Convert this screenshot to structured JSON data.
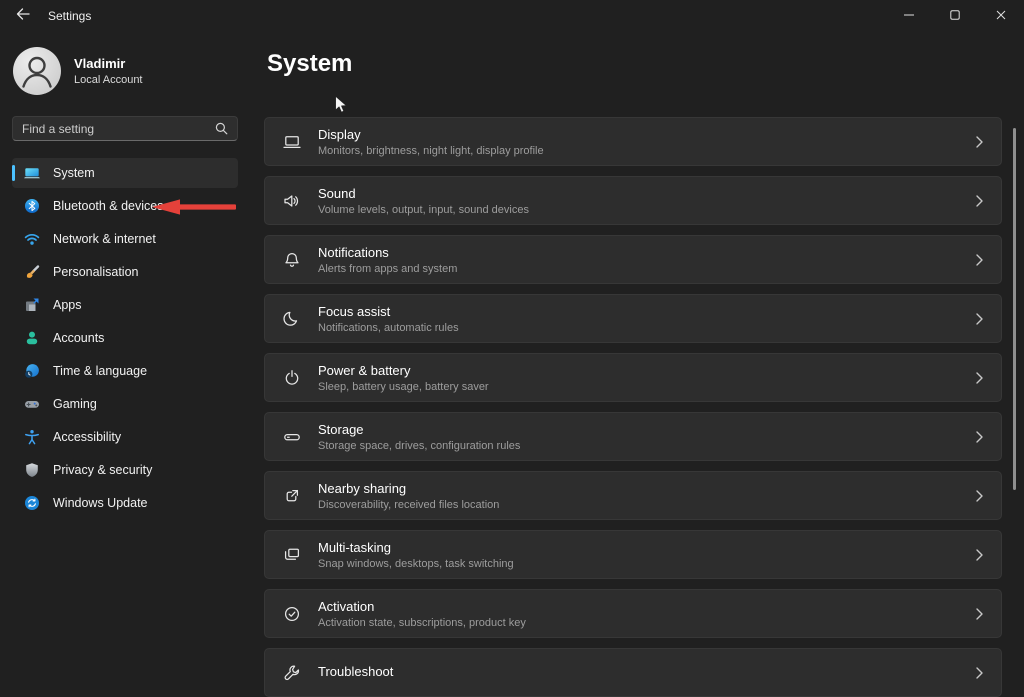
{
  "window": {
    "title": "Settings"
  },
  "icons": {
    "back": "arrow-left",
    "search": "magnifier",
    "minimize": "dash",
    "maximize": "square",
    "close": "x",
    "chevron": "chevron-right",
    "cursor": "mouse-pointer",
    "annotation": "red-arrow-left"
  },
  "sidebar": {
    "user": {
      "name": "Vladimir",
      "account_type": "Local Account"
    },
    "search": {
      "placeholder": "Find a setting"
    },
    "items": [
      {
        "label": "System",
        "icon": "system-icon",
        "selected": true
      },
      {
        "label": "Bluetooth & devices",
        "icon": "bluetooth-icon",
        "selected": false
      },
      {
        "label": "Network & internet",
        "icon": "network-icon",
        "selected": false
      },
      {
        "label": "Personalisation",
        "icon": "personalisation-icon",
        "selected": false
      },
      {
        "label": "Apps",
        "icon": "apps-icon",
        "selected": false
      },
      {
        "label": "Accounts",
        "icon": "accounts-icon",
        "selected": false
      },
      {
        "label": "Time & language",
        "icon": "time-language-icon",
        "selected": false
      },
      {
        "label": "Gaming",
        "icon": "gaming-icon",
        "selected": false
      },
      {
        "label": "Accessibility",
        "icon": "accessibility-icon",
        "selected": false
      },
      {
        "label": "Privacy & security",
        "icon": "privacy-security-icon",
        "selected": false
      },
      {
        "label": "Windows Update",
        "icon": "windows-update-icon",
        "selected": false
      }
    ]
  },
  "main": {
    "title": "System",
    "cards": [
      {
        "title": "Display",
        "subtitle": "Monitors, brightness, night light, display profile",
        "icon": "display-icon"
      },
      {
        "title": "Sound",
        "subtitle": "Volume levels, output, input, sound devices",
        "icon": "sound-icon"
      },
      {
        "title": "Notifications",
        "subtitle": "Alerts from apps and system",
        "icon": "notifications-icon"
      },
      {
        "title": "Focus assist",
        "subtitle": "Notifications, automatic rules",
        "icon": "focus-assist-icon"
      },
      {
        "title": "Power & battery",
        "subtitle": "Sleep, battery usage, battery saver",
        "icon": "power-battery-icon"
      },
      {
        "title": "Storage",
        "subtitle": "Storage space, drives, configuration rules",
        "icon": "storage-icon"
      },
      {
        "title": "Nearby sharing",
        "subtitle": "Discoverability, received files location",
        "icon": "nearby-sharing-icon"
      },
      {
        "title": "Multi-tasking",
        "subtitle": "Snap windows, desktops, task switching",
        "icon": "multi-tasking-icon"
      },
      {
        "title": "Activation",
        "subtitle": "Activation state, subscriptions, product key",
        "icon": "activation-icon"
      },
      {
        "title": "Troubleshoot",
        "subtitle": "",
        "icon": "troubleshoot-icon"
      }
    ]
  },
  "annotation": {
    "type": "arrow-left",
    "target": "Bluetooth & devices",
    "color": "#e5413a"
  },
  "colors": {
    "accent": "#4cc2ff",
    "window_bg": "#202020",
    "card_bg": "#2d2d2d",
    "text_secondary": "#9d9d9d",
    "annotation_red": "#e5413a"
  }
}
